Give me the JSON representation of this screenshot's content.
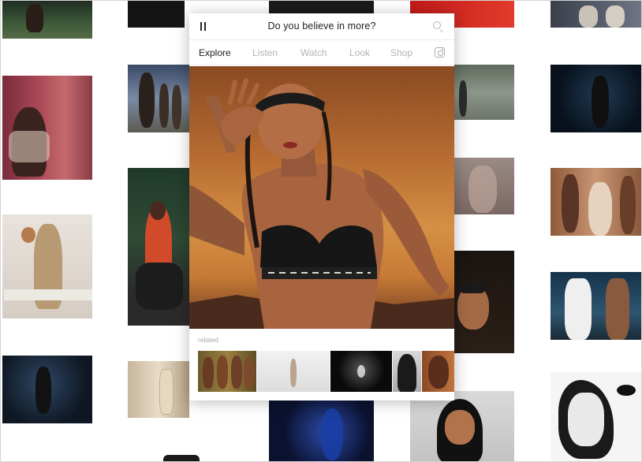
{
  "panel": {
    "title": "Do you believe in more?",
    "nav": [
      {
        "label": "Explore",
        "active": true
      },
      {
        "label": "Listen",
        "active": false
      },
      {
        "label": "Watch",
        "active": false
      },
      {
        "label": "Look",
        "active": false
      },
      {
        "label": "Shop",
        "active": false
      }
    ],
    "related_label": "related"
  },
  "icons": [
    "pause-icon",
    "search-icon",
    "instagram-icon"
  ],
  "colors": {
    "accent_text": "#222222",
    "muted_text": "#b3b3b3",
    "hero_orange": "#c77a36"
  }
}
